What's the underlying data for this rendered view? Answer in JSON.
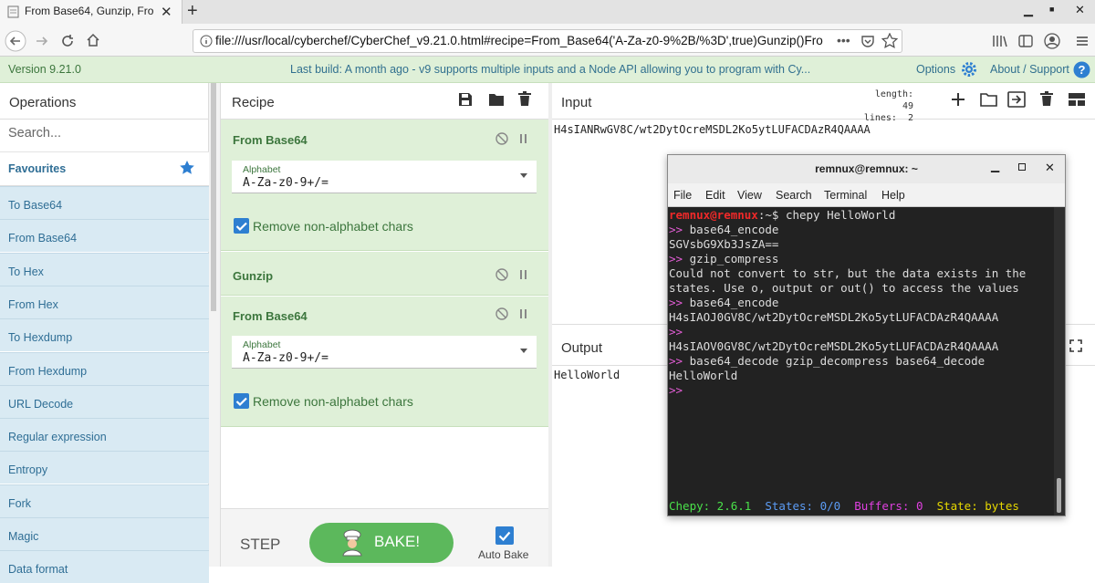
{
  "browser": {
    "tab_title": "From Base64, Gunzip, Fro",
    "url": "file:///usr/local/cyberchef/CyberChef_v9.21.0.html#recipe=From_Base64('A-Za-z0-9%2B/%3D',true)Gunzip()Fro",
    "url_more": "•••"
  },
  "banner": {
    "version": "Version 9.21.0",
    "last_build": "Last build: A month ago - v9 supports multiple inputs and a Node API allowing you to program with Cy...",
    "options": "Options",
    "about": "About / Support"
  },
  "operations": {
    "title": "Operations",
    "search_placeholder": "Search...",
    "favourites": "Favourites",
    "items": [
      "To Base64",
      "From Base64",
      "To Hex",
      "From Hex",
      "To Hexdump",
      "From Hexdump",
      "URL Decode",
      "Regular expression",
      "Entropy",
      "Fork",
      "Magic",
      "Data format"
    ]
  },
  "recipe": {
    "title": "Recipe",
    "ingredients": [
      {
        "name": "From Base64",
        "alphabet_label": "Alphabet",
        "alphabet": "A-Za-z0-9+/=",
        "checkbox": "Remove non-alphabet chars"
      },
      {
        "name": "Gunzip"
      },
      {
        "name": "From Base64",
        "alphabet_label": "Alphabet",
        "alphabet": "A-Za-z0-9+/=",
        "checkbox": "Remove non-alphabet chars"
      }
    ],
    "step": "STEP",
    "bake": "BAKE!",
    "auto_bake": "Auto Bake"
  },
  "input": {
    "title": "Input",
    "length": "length: 49",
    "lines": "lines:  2",
    "text": "H4sIANRwGV8C/wt2DytOcreMSDL2Ko5ytLUFACDAzR4QAAAA"
  },
  "output": {
    "title": "Output",
    "text": "HelloWorld"
  },
  "terminal": {
    "title": "remnux@remnux: ~",
    "menu": [
      "File",
      "Edit",
      "View",
      "Search",
      "Terminal",
      "Help"
    ],
    "prompt_user": "remnux@remnux",
    "prompt_rest": ":~$ chepy HelloWorld",
    "lines": [
      {
        "p": ">>",
        "t": " base64_encode"
      },
      {
        "p": "",
        "t": "SGVsbG9Xb3JsZA=="
      },
      {
        "p": ">>",
        "t": " gzip_compress"
      },
      {
        "p": "",
        "t": "Could not convert to str, but the data exists in the"
      },
      {
        "p": "",
        "t": "states. Use o, output or out() to access the values"
      },
      {
        "p": ">>",
        "t": " base64_encode"
      },
      {
        "p": "",
        "t": "H4sIAOJ0GV8C/wt2DytOcreMSDL2Ko5ytLUFACDAzR4QAAAA"
      },
      {
        "p": ">>",
        "t": ""
      },
      {
        "p": "",
        "t": "H4sIAOV0GV8C/wt2DytOcreMSDL2Ko5ytLUFACDAzR4QAAAA"
      },
      {
        "p": ">>",
        "t": " base64_decode gzip_decompress base64_decode"
      },
      {
        "p": "",
        "t": "HelloWorld"
      },
      {
        "p": ">>",
        "t": ""
      }
    ],
    "status": {
      "version": "Chepy: 2.6.1",
      "states": "States: 0/0",
      "buffers": "Buffers: 0",
      "state": "State: bytes"
    }
  },
  "colors": {
    "banner_bg": "#dff0d8",
    "op_bg": "#d9eaf3",
    "bake_green": "#5cb85c",
    "accent_blue": "#2e7fd1"
  }
}
